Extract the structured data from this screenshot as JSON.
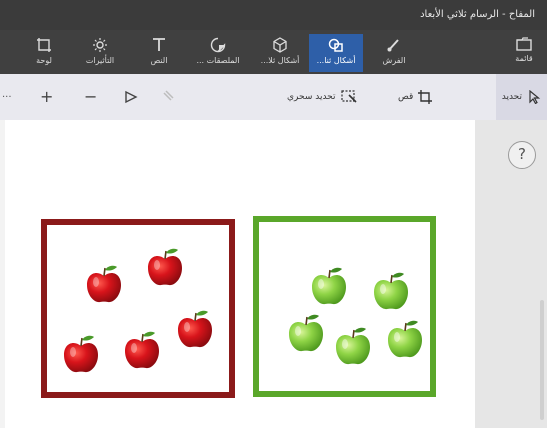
{
  "window": {
    "title": "المفاح - الرسام ثلاثي الأبعاد"
  },
  "ribbon": {
    "tools": [
      {
        "id": "menu",
        "label": "قائمة",
        "icon": "folder-icon"
      },
      {
        "id": "brushes",
        "label": "الفرش",
        "icon": "brush-icon"
      },
      {
        "id": "2d-shapes",
        "label": "أشكال ثنا...",
        "icon": "shapes-2d-icon",
        "active": true
      },
      {
        "id": "3d-shapes",
        "label": "أشكال ثلا...",
        "icon": "cube-icon"
      },
      {
        "id": "stickers",
        "label": "الملصقات ...",
        "icon": "sticker-icon"
      },
      {
        "id": "text",
        "label": "النص",
        "icon": "text-icon"
      },
      {
        "id": "effects",
        "label": "التأثيرات",
        "icon": "effects-icon"
      },
      {
        "id": "canvas",
        "label": "لوحة",
        "icon": "canvas-icon"
      }
    ]
  },
  "commandbar": {
    "select_label": "تحديد",
    "crop_label": "قص",
    "magic_select_label": "تحديد سحري",
    "zoom_in": "+",
    "zoom_out": "−",
    "more": "···"
  },
  "help": {
    "label": "?"
  },
  "scene": {
    "red_box_color": "#8b1a1a",
    "green_box_color": "#5aa72a",
    "red_apple_count": 5,
    "green_apple_count": 5
  }
}
